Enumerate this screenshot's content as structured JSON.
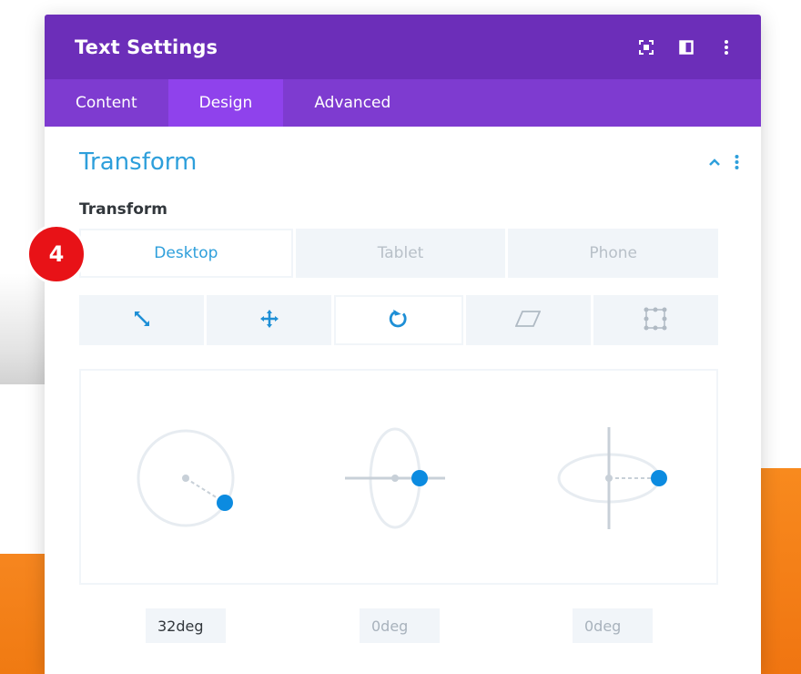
{
  "modal": {
    "title": "Text Settings",
    "header_icons": [
      "expand-icon",
      "sidebar-layout-icon",
      "more-vertical-icon"
    ],
    "tabs": [
      {
        "label": "Content",
        "active": false
      },
      {
        "label": "Design",
        "active": true
      },
      {
        "label": "Advanced",
        "active": false
      }
    ]
  },
  "section": {
    "title": "Transform",
    "field_label": "Transform"
  },
  "device_tabs": [
    {
      "label": "Desktop",
      "active": true
    },
    {
      "label": "Tablet",
      "active": false
    },
    {
      "label": "Phone",
      "active": false
    }
  ],
  "tool_tabs": [
    {
      "icon": "scale-icon",
      "active": false
    },
    {
      "icon": "move-icon",
      "active": false
    },
    {
      "icon": "rotate-icon",
      "active": true
    },
    {
      "icon": "skew-icon",
      "active": false
    },
    {
      "icon": "transform-origin-icon",
      "active": false
    }
  ],
  "rotation": {
    "values": [
      "32deg",
      "0deg",
      "0deg"
    ]
  },
  "badge": {
    "label": "4"
  },
  "colors": {
    "header": "#6c2eb9",
    "tabs_bar": "#7e3bd0",
    "active_tab": "#8f42ec",
    "accent_blue": "#2e9fdb",
    "handle_blue": "#0c8be0",
    "badge_red": "#e81217",
    "orange": "#f6861f"
  }
}
